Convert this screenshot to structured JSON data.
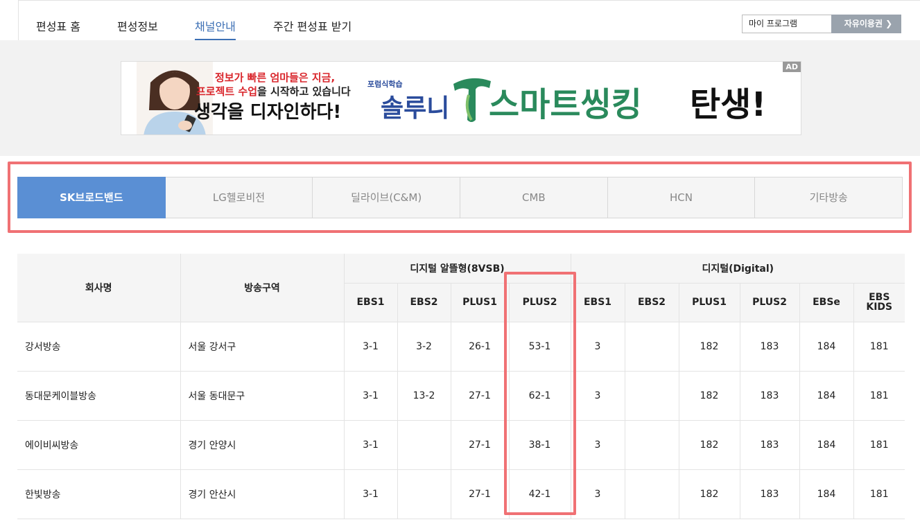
{
  "nav": {
    "tabs": [
      "편성표 홈",
      "편성정보",
      "채널안내",
      "주간 편성표 받기"
    ],
    "active_tab": 2,
    "my_program_label": "마이 프로그램",
    "free_use_label": "자유이용권 ❯"
  },
  "ad": {
    "badge": "AD",
    "line1": "정보가 빠른 엄마들은 지금,",
    "line2_red": "프로젝트 수업",
    "line2_black": "을 시작하고 있습니다",
    "line3": "생각을 디자인하다!",
    "small": "포럼식학습",
    "brand": "솔루니",
    "smart": "스마트씽킹",
    "birth": "탄생!"
  },
  "providers": {
    "items": [
      "SK브로드밴드",
      "LG헬로비전",
      "딜라이브(C&M)",
      "CMB",
      "HCN",
      "기타방송"
    ],
    "active": 0
  },
  "table": {
    "company_header": "회사명",
    "area_header": "방송구역",
    "group1": "디지털 알뜰형(8VSB)",
    "group2": "디지털(Digital)",
    "sub1": [
      "EBS1",
      "EBS2",
      "PLUS1",
      "PLUS2"
    ],
    "sub2": [
      "EBS1",
      "EBS2",
      "PLUS1",
      "PLUS2",
      "EBSe",
      "EBS KIDS"
    ],
    "rows": [
      {
        "company": "강서방송",
        "area": "서울 강서구",
        "v": [
          "3-1",
          "3-2",
          "26-1",
          "53-1",
          "3",
          "",
          "182",
          "183",
          "184",
          "181"
        ]
      },
      {
        "company": "동대문케이블방송",
        "area": "서울 동대문구",
        "v": [
          "3-1",
          "13-2",
          "27-1",
          "62-1",
          "3",
          "",
          "182",
          "183",
          "184",
          "181"
        ]
      },
      {
        "company": "에이비씨방송",
        "area": "경기 안양시",
        "v": [
          "3-1",
          "",
          "27-1",
          "38-1",
          "3",
          "",
          "182",
          "183",
          "184",
          "181"
        ]
      },
      {
        "company": "한빛방송",
        "area": "경기 안산시",
        "v": [
          "3-1",
          "",
          "27-1",
          "42-1",
          "3",
          "",
          "182",
          "183",
          "184",
          "181"
        ]
      }
    ]
  },
  "colors": {
    "accent": "#5a8fd4",
    "nav_active": "#3c6fb4",
    "highlight": "#f07174"
  }
}
